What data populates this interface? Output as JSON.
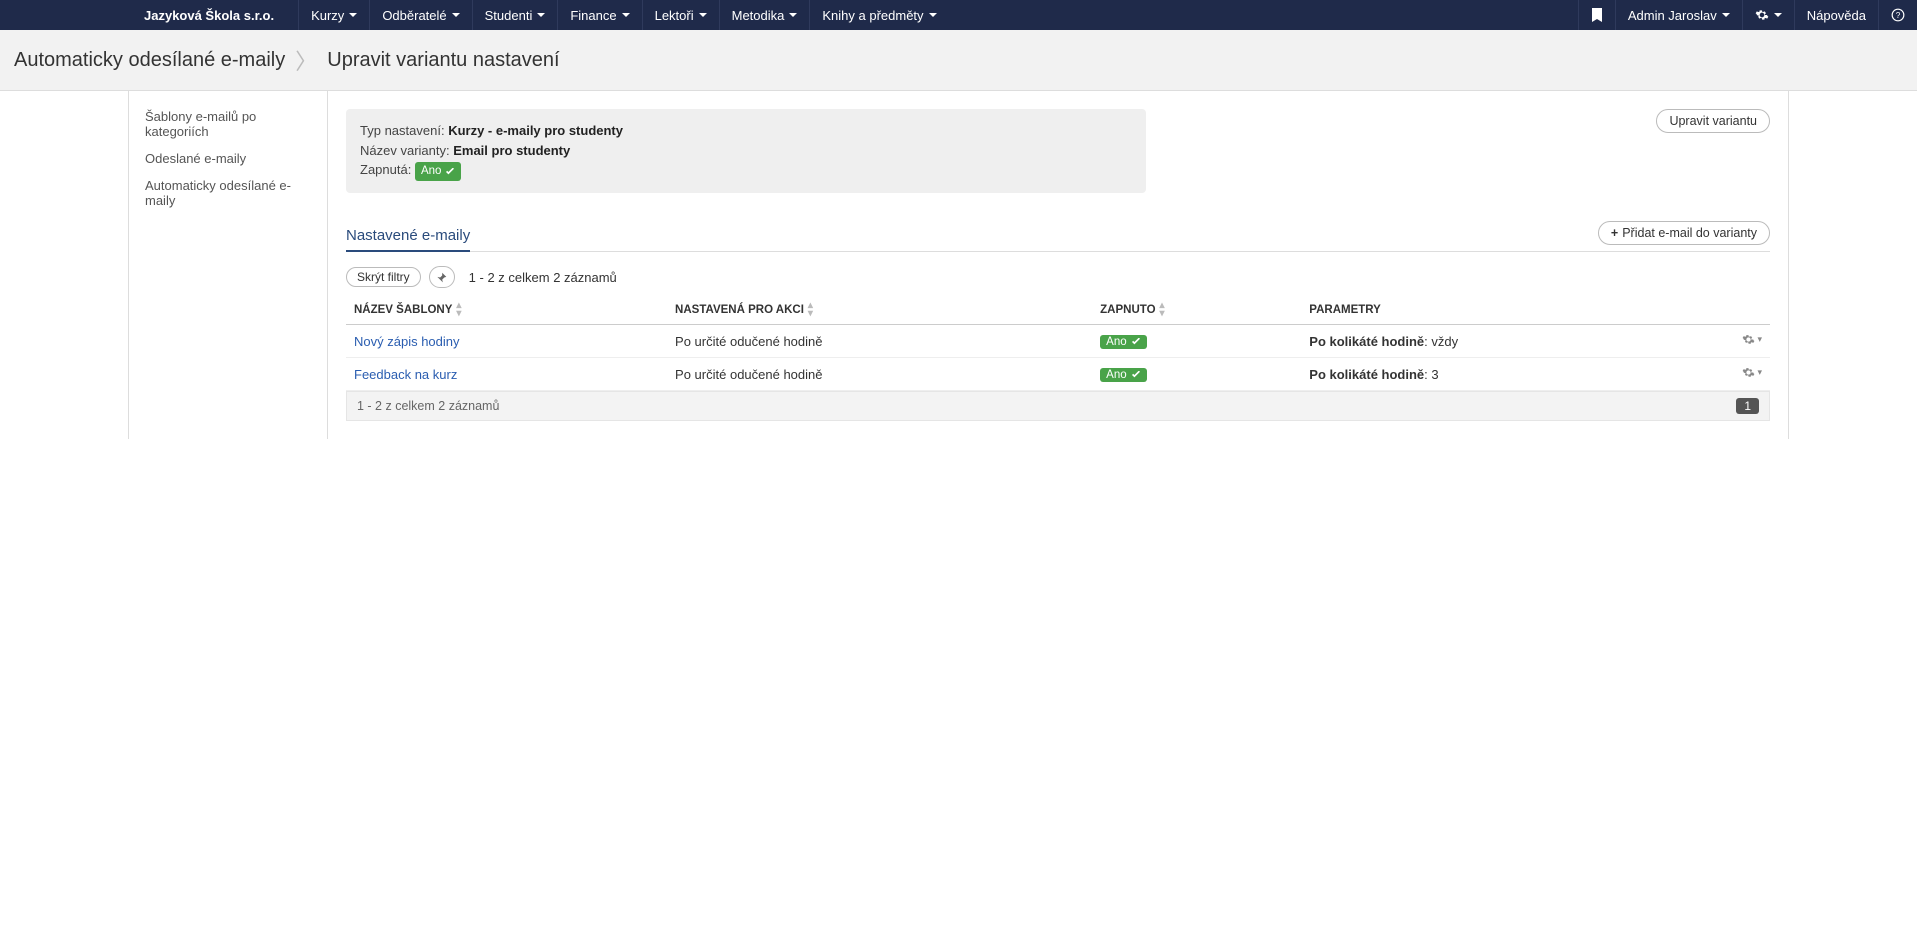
{
  "brand": "Jazyková Škola s.r.o.",
  "nav": {
    "items": [
      "Kurzy",
      "Odběratelé",
      "Studenti",
      "Finance",
      "Lektoři",
      "Metodika",
      "Knihy a předměty"
    ],
    "user": "Admin Jaroslav",
    "help": "Nápověda"
  },
  "breadcrumb": {
    "root": "Automaticky odesílané e-maily",
    "current": "Upravit variantu nastavení"
  },
  "sidebar": {
    "items": [
      "Šablony e-mailů po kategoriích",
      "Odeslané e-maily",
      "Automaticky odesílané e-maily"
    ]
  },
  "buttons": {
    "edit_variant": "Upravit variantu",
    "add_email": "Přidat e-mail do varianty",
    "hide_filters": "Skrýt filtry"
  },
  "info": {
    "type_label": "Typ nastavení:",
    "type_value": "Kurzy - e-maily pro studenty",
    "name_label": "Název varianty:",
    "name_value": "Email pro studenty",
    "enabled_label": "Zapnutá:",
    "enabled_badge": "Ano"
  },
  "section": {
    "title": "Nastavené e-maily"
  },
  "table": {
    "count_text": "1 - 2 z celkem 2 záznamů",
    "headers": {
      "name": "NÁZEV ŠABLONY",
      "action": "NASTAVENÁ PRO AKCI",
      "enabled": "ZAPNUTO",
      "params": "PARAMETRY"
    },
    "rows": [
      {
        "name": "Nový zápis hodiny",
        "action": "Po určité odučené hodině",
        "enabled": "Ano",
        "param_label": "Po kolikáté hodině",
        "param_value": "vždy"
      },
      {
        "name": "Feedback na kurz",
        "action": "Po určité odučené hodině",
        "enabled": "Ano",
        "param_label": "Po kolikáté hodině",
        "param_value": "3"
      }
    ],
    "footer_text": "1 - 2 z celkem 2 záznamů",
    "page": "1"
  }
}
